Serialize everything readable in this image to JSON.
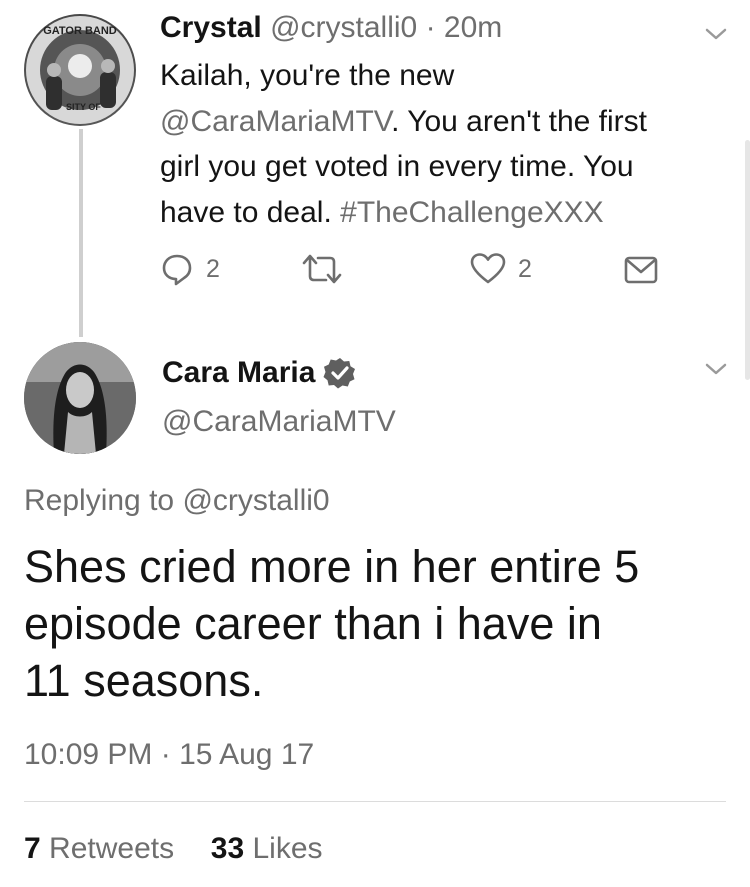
{
  "tweet1": {
    "display_name": "Crystal",
    "handle": "@crystalli0",
    "separator": "·",
    "time": "20m",
    "text_line1": "Kailah, you're the new",
    "mention": "@CaraMariaMTV",
    "text_line2_suffix": ". You aren't the first",
    "text_line3": "girl you get voted in every time. You",
    "text_line4_prefix": "have to deal. ",
    "hashtag": "#TheChallengeXXX",
    "replies": "2",
    "likes": "2",
    "avatar_badge_top": "GATOR BAND",
    "avatar_badge_bottom": "SITY OF"
  },
  "tweet2": {
    "display_name": "Cara Maria",
    "handle": "@CaraMariaMTV",
    "replying_label": "Replying to ",
    "replying_handle": "@crystalli0",
    "text_line1": "Shes cried more in her entire 5",
    "text_line2": "episode career than i have in",
    "text_line3": "11 seasons.",
    "timestamp": "10:09 PM · 15 Aug 17",
    "retweets_count": "7",
    "retweets_label": "Retweets",
    "likes_count": "33",
    "likes_label": "Likes"
  },
  "icons": {
    "reply": "reply-icon",
    "retweet": "retweet-icon",
    "like": "heart-icon",
    "dm": "envelope-icon",
    "menu": "chevron-down-icon",
    "verified": "verified-badge-icon"
  }
}
